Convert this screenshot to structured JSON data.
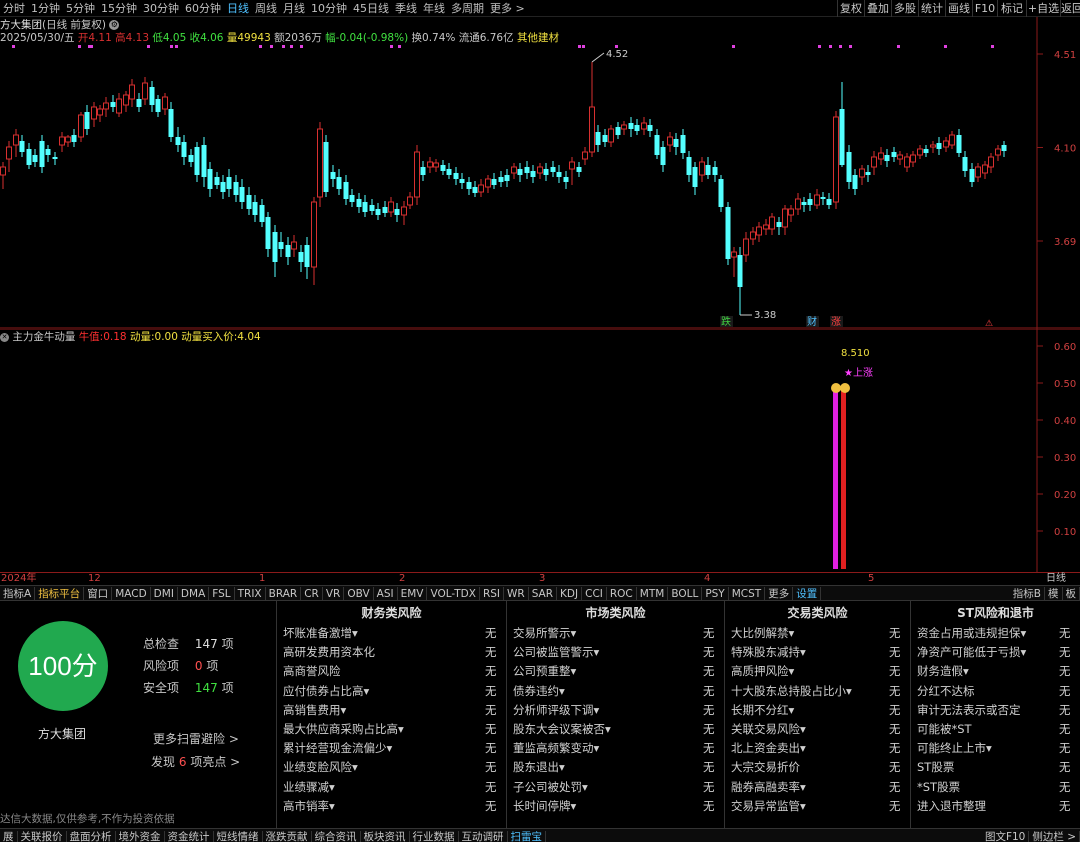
{
  "period_bar": {
    "items": [
      "分时",
      "1分钟",
      "5分钟",
      "15分钟",
      "30分钟",
      "60分钟",
      "日线",
      "周线",
      "月线",
      "10分钟",
      "45日线",
      "季线",
      "年线",
      "多周期",
      "更多 >"
    ],
    "active_index": 6,
    "right_items": [
      "复权",
      "叠加",
      "多股",
      "统计",
      "画线",
      "F10",
      "标记",
      "+自选",
      "返回"
    ]
  },
  "title_line": {
    "stock": "方大集团",
    "mode": "(日线 前复权)"
  },
  "quote_line": {
    "date": "2025/05/30/五",
    "open_label": "开",
    "open": "4.11",
    "high_label": "高",
    "high": "4.13",
    "low_label": "低",
    "low": "4.05",
    "close_label": "收",
    "close": "4.06",
    "volume_label": "量",
    "volume": "49943",
    "amount_label": "额",
    "amount": "2036万",
    "change_label": "幅",
    "change": "-0.04(-0.98%)",
    "turnover_label": "换",
    "turnover": "0.74%",
    "float_label": "流通",
    "float": "6.76亿",
    "industry": "其他建材"
  },
  "price_axis": {
    "labels": [
      "4.51",
      "4.10",
      "3.69"
    ],
    "colors": {
      "axis": "#d04040",
      "up": "#d83030",
      "down": "#54ffff"
    }
  },
  "price_annotations": {
    "high_mark": "4.52",
    "low_mark": "3.38",
    "badges": [
      "跌",
      "财",
      "涨"
    ]
  },
  "indicator_line": {
    "name": "主力金牛动量",
    "bull_label": "牛值:",
    "bull_value": "0.18",
    "momentum_label": "动量:",
    "momentum_value": "0.00",
    "buy_label": "动量买入价:",
    "buy_value": "4.04"
  },
  "indicator_axis": {
    "labels": [
      "0.60",
      "0.50",
      "0.40",
      "0.30",
      "0.20",
      "0.10"
    ]
  },
  "indicator_annotations": {
    "peak_value": "8.510",
    "signal": "★上涨"
  },
  "date_axis": {
    "labels": [
      "2024年",
      "12",
      "1",
      "2",
      "3",
      "4",
      "5"
    ]
  },
  "date_axis_right": "日线",
  "tabs": {
    "items": [
      "指标A",
      "指标平台",
      "窗口",
      "MACD",
      "DMI",
      "DMA",
      "FSL",
      "TRIX",
      "BRAR",
      "CR",
      "VR",
      "OBV",
      "ASI",
      "EMV",
      "VOL-TDX",
      "RSI",
      "WR",
      "SAR",
      "KDJ",
      "CCI",
      "ROC",
      "MTM",
      "BOLL",
      "PSY",
      "MCST",
      "更多",
      "设置"
    ],
    "right_items": [
      "指标B",
      "模",
      "板"
    ]
  },
  "scan_panel": {
    "score": "100分",
    "stock_name": "方大集团",
    "total_label": "总检查",
    "total_value": "147",
    "total_unit": "项",
    "risk_label": "风险项",
    "risk_value": "0",
    "risk_unit": "项",
    "safe_label": "安全项",
    "safe_value": "147",
    "safe_unit": "项",
    "more_link": "更多扫雷避险 >",
    "found_prefix": "发现",
    "found_value": "6",
    "found_suffix": "项亮点 >",
    "disclaimer": "达信大数据,仅供参考,不作为投资依据",
    "columns": [
      {
        "title": "财务类风险",
        "rows": [
          [
            "坏账准备激增▾",
            "无"
          ],
          [
            "高研发费用资本化",
            "无"
          ],
          [
            "高商誉风险",
            "无"
          ],
          [
            "应付债券占比高▾",
            "无"
          ],
          [
            "高销售费用▾",
            "无"
          ],
          [
            "最大供应商采购占比高▾",
            "无"
          ],
          [
            "累计经营现金流偏少▾",
            "无"
          ],
          [
            "业绩变脸风险▾",
            "无"
          ],
          [
            "业绩骤减▾",
            "无"
          ],
          [
            "高市销率▾",
            "无"
          ]
        ]
      },
      {
        "title": "市场类风险",
        "rows": [
          [
            "交易所警示▾",
            "无"
          ],
          [
            "公司被监管警示▾",
            "无"
          ],
          [
            "公司预重整▾",
            "无"
          ],
          [
            "债券违约▾",
            "无"
          ],
          [
            "分析师评级下调▾",
            "无"
          ],
          [
            "股东大会议案被否▾",
            "无"
          ],
          [
            "董监高频繁变动▾",
            "无"
          ],
          [
            "股东退出▾",
            "无"
          ],
          [
            "子公司被处罚▾",
            "无"
          ],
          [
            "长时间停牌▾",
            "无"
          ]
        ]
      },
      {
        "title": "交易类风险",
        "rows": [
          [
            "大比例解禁▾",
            "无"
          ],
          [
            "特殊股东减持▾",
            "无"
          ],
          [
            "高质押风险▾",
            "无"
          ],
          [
            "十大股东总持股占比小▾",
            "无"
          ],
          [
            "长期不分红▾",
            "无"
          ],
          [
            "关联交易风险▾",
            "无"
          ],
          [
            "北上资金卖出▾",
            "无"
          ],
          [
            "大宗交易折价",
            "无"
          ],
          [
            "融券高融卖率▾",
            "无"
          ],
          [
            "交易异常监管▾",
            "无"
          ]
        ]
      },
      {
        "title": "ST风险和退市",
        "rows": [
          [
            "资金占用或违规担保▾",
            "无"
          ],
          [
            "净资产可能低于亏损▾",
            "无"
          ],
          [
            "财务造假▾",
            "无"
          ],
          [
            "分红不达标",
            "无"
          ],
          [
            "审计无法表示或否定",
            "无"
          ],
          [
            "可能被*ST",
            "无"
          ],
          [
            "可能终止上市▾",
            "无"
          ],
          [
            "ST股票",
            "无"
          ],
          [
            "*ST股票",
            "无"
          ],
          [
            "进入退市整理",
            "无"
          ]
        ]
      }
    ]
  },
  "bottom_nav": {
    "items": [
      "展",
      "关联报价",
      "盘面分析",
      "境外资金",
      "资金统计",
      "短线情绪",
      "涨跌贡献",
      "综合资讯",
      "板块资讯",
      "行业数据",
      "互动调研",
      "扫雷宝"
    ],
    "active_index": 11,
    "right_items": [
      "图文F10",
      "侧边栏 >"
    ]
  }
}
